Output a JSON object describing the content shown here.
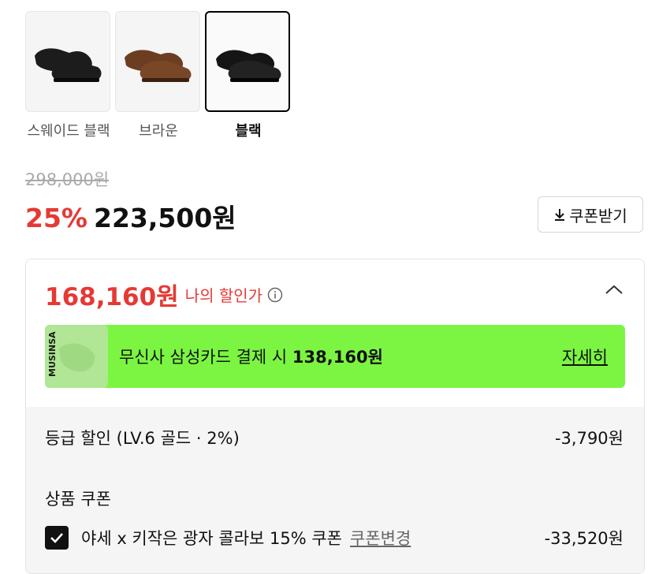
{
  "variants": [
    {
      "label": "스웨이드 블랙",
      "selected": false
    },
    {
      "label": "브라운",
      "selected": false
    },
    {
      "label": "블랙",
      "selected": true
    }
  ],
  "price": {
    "original": "298,000원",
    "discount_rate": "25%",
    "sale": "223,500원"
  },
  "coupon_button": {
    "label": "쿠폰받기"
  },
  "my_discount": {
    "amount": "168,160원",
    "label": "나의 할인가"
  },
  "promo": {
    "text": "무신사 삼성카드 결제 시",
    "amount": "138,160원",
    "detail_label": "자세히",
    "card_brand": "MUSINSA",
    "bg_color": "#7bf542"
  },
  "grade_discount": {
    "label": "등급 할인 (LV.6 골드 · 2%)",
    "value": "-3,790원"
  },
  "product_coupon": {
    "title": "상품 쿠폰",
    "item_label": "야세 x 키작은 광자 콜라보 15% 쿠폰",
    "change_label": "쿠폰변경",
    "value": "-33,520원",
    "checked": true
  },
  "colors": {
    "accent_red": "#e53935",
    "promo_green": "#7bf542"
  }
}
